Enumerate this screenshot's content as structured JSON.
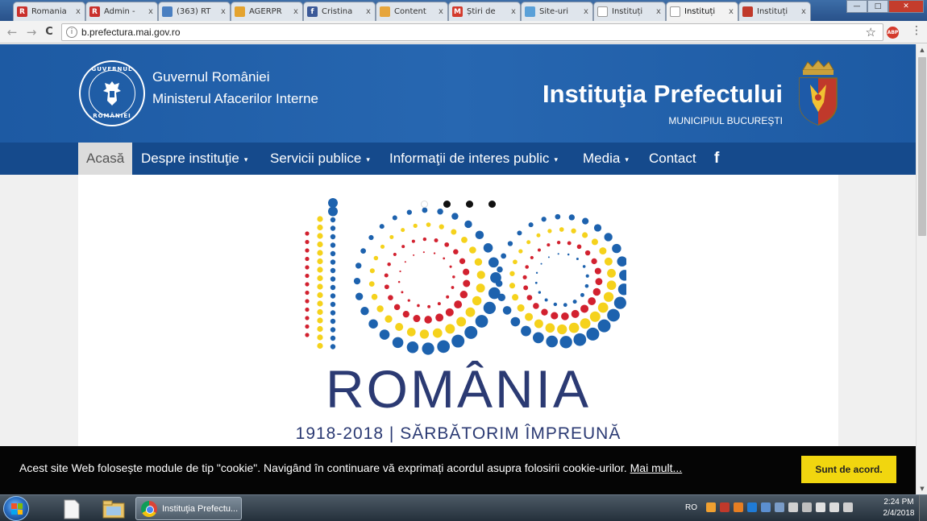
{
  "browser": {
    "tabs": [
      {
        "title": "Romania",
        "fav_color": "#c9302c",
        "fav_glyph": "R",
        "active": false
      },
      {
        "title": "Admin -",
        "fav_color": "#c9302c",
        "fav_glyph": "R",
        "active": false
      },
      {
        "title": "(363) RT",
        "fav_color": "#4a7fc1",
        "fav_glyph": "",
        "active": false
      },
      {
        "title": "AGERPR",
        "fav_color": "#e4a32f",
        "fav_glyph": "",
        "active": false
      },
      {
        "title": "Cristina",
        "fav_color": "#3b5998",
        "fav_glyph": "f",
        "active": false
      },
      {
        "title": "Content",
        "fav_color": "#e6a53c",
        "fav_glyph": "",
        "active": false
      },
      {
        "title": "Știri de",
        "fav_color": "#d33a2c",
        "fav_glyph": "M",
        "active": false
      },
      {
        "title": "Site-uri",
        "fav_color": "#5aa0d8",
        "fav_glyph": "",
        "active": false
      },
      {
        "title": "Instituți",
        "fav_color": "#ffffff",
        "fav_glyph": "",
        "active": false
      },
      {
        "title": "Instituți",
        "fav_color": "#ffffff",
        "fav_glyph": "",
        "active": true
      },
      {
        "title": "Instituți",
        "fav_color": "#c0392b",
        "fav_glyph": "",
        "active": false
      }
    ],
    "tab_close": "x",
    "url": "b.prefectura.mai.gov.ro",
    "back": "←",
    "forward": "→",
    "reload": "C",
    "star": "☆",
    "abp": "ABP",
    "menu": "⋮",
    "win_min": "—",
    "win_max": "□",
    "win_close": "✕"
  },
  "header": {
    "gov_line1": "Guvernul României",
    "gov_line2": "Ministerul Afacerilor Interne",
    "seal_top": "GUVERNUL",
    "seal_bottom": "ROMÂNIEI",
    "title": "Instituţia Prefectului",
    "subtitle": "MUNICIPIUL BUCUREŞTI"
  },
  "nav": {
    "items": [
      {
        "label": "Acasă",
        "dropdown": false
      },
      {
        "label": "Despre instituţie",
        "dropdown": true
      },
      {
        "label": "Servicii publice",
        "dropdown": true
      },
      {
        "label": "Informaţii de interes public",
        "dropdown": true
      },
      {
        "label": "Media",
        "dropdown": true
      },
      {
        "label": "Contact",
        "dropdown": false
      }
    ],
    "caret": "▾",
    "facebook": "f"
  },
  "hero": {
    "word": "ROMÂNIA",
    "subline": "1918-2018 | SĂRBĂTORIM ÎMPREUNĂ",
    "slides_total": 4,
    "active_slide": 1,
    "colors": {
      "blue": "#1d62ae",
      "yellow": "#f5d21c",
      "red": "#d2212f",
      "navy": "#2b3a73"
    }
  },
  "cookie": {
    "text": "Acest site Web folosește module de tip \"cookie\". Navigând în continuare vă exprimați acordul asupra folosirii cookie-urilor.",
    "more": "Mai mult...",
    "accept": "Sunt de acord."
  },
  "taskbar": {
    "task_label": "Instituţia Prefectu...",
    "lang": "RO",
    "time": "2:24 PM",
    "date": "2/4/2018"
  },
  "colors": {
    "header_blue": "#1e5da8",
    "nav_blue": "#154a8c",
    "cookie_button": "#f1d60f"
  }
}
